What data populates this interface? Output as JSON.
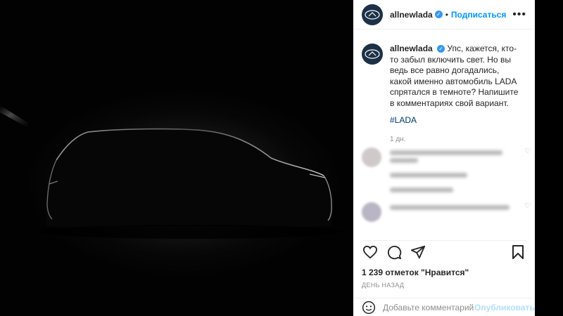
{
  "post": {
    "username": "allnewlada",
    "follow_label": "Подписаться",
    "separator": "•",
    "more_label": "•••",
    "caption": "Упс, кажется, кто-то забыл включить свет. Но вы ведь все равно догадались, какой именно автомобиль LADA спрятался в темноте? Напишите в комментариях свой вариант.",
    "hashtag": "#LADA",
    "caption_time": "1 дн.",
    "likes": "1 239 отметок \"Нравится\"",
    "post_time": "ДЕНЬ НАЗАД"
  },
  "comment_box": {
    "placeholder": "Добавьте комментарий...",
    "publish_label": "Опубликовать"
  },
  "icons": {
    "verified": "verified-badge-icon",
    "like": "heart-icon",
    "comment": "comment-icon",
    "share": "paper-plane-icon",
    "save": "bookmark-icon",
    "emoji": "emoji-icon"
  },
  "colors": {
    "follow": "#0095f6",
    "verified": "#3897f0",
    "hashtag": "#00376b",
    "publish_disabled": "#b2dffc"
  }
}
